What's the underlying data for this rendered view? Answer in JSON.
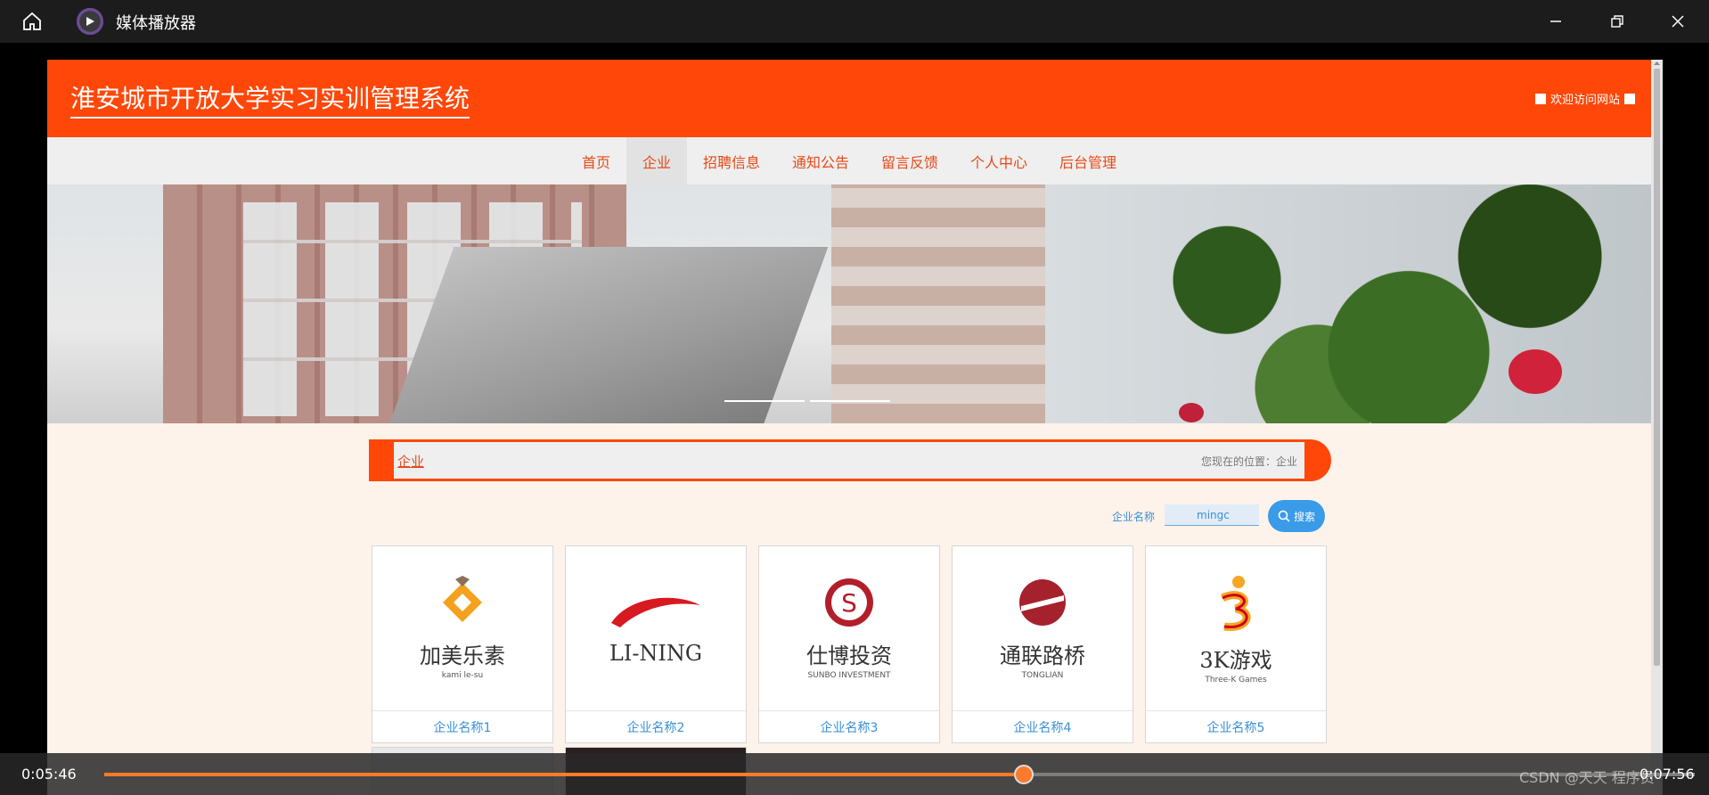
{
  "player": {
    "title": "媒体播放器",
    "current_time": "0:05:46",
    "total_time": "0:07:56",
    "progress": 0.578,
    "watermark": "CSDN @天天 程序员"
  },
  "site": {
    "title": "淮安城市开放大学实习实训管理系统",
    "welcome": "欢迎访问网站"
  },
  "nav": {
    "items": [
      {
        "label": "首页"
      },
      {
        "label": "企业"
      },
      {
        "label": "招聘信息"
      },
      {
        "label": "通知公告"
      },
      {
        "label": "留言反馈"
      },
      {
        "label": "个人中心"
      },
      {
        "label": "后台管理"
      }
    ],
    "active_index": 1
  },
  "breadcrumb": {
    "title": "企业",
    "location": "您现在的位置：企业"
  },
  "search": {
    "label": "企业名称",
    "value": "mingc",
    "button": "搜索"
  },
  "companies": [
    {
      "name": "企业名称1",
      "logo_text": "加美乐素",
      "logo_sub": "kami le-su",
      "logo": "kamilesu-logo"
    },
    {
      "name": "企业名称2",
      "logo_text": "LI-NING",
      "logo_sub": "",
      "logo": "lining-logo"
    },
    {
      "name": "企业名称3",
      "logo_text": "仕博投资",
      "logo_sub": "SUNBO INVESTMENT",
      "logo": "sunbo-logo"
    },
    {
      "name": "企业名称4",
      "logo_text": "通联路桥",
      "logo_sub": "TONGLIAN",
      "logo": "tonglian-logo"
    },
    {
      "name": "企业名称5",
      "logo_text": "3K游戏",
      "logo_sub": "Three-K Games",
      "logo": "3k-games-logo"
    }
  ],
  "colors": {
    "brand": "#fe4709",
    "nav_text": "#e64a19",
    "link": "#3a8fd6",
    "progress": "#ff7a2b",
    "search_button": "#3a9be8"
  }
}
